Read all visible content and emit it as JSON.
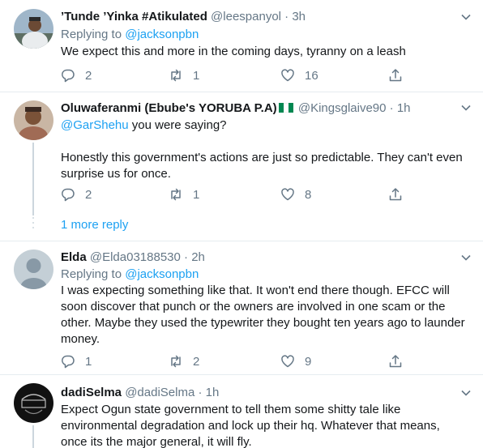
{
  "tweets": [
    {
      "name": "’Tunde ’Yinka #Atikulated",
      "handle": "@leespanyol",
      "sep": "·",
      "time": "3h",
      "replying_prefix": "Replying to ",
      "replying_to": "@jacksonpbn",
      "text": "We expect this and more in the coming days, tyranny on a leash",
      "replies": "2",
      "retweets": "1",
      "likes": "16"
    },
    {
      "name": "Oluwaferanmi (Ebube's YORUBA P.A)",
      "handle": "@Kingsglaive90",
      "sep": "·",
      "time": "1h",
      "mention": "@GarShehu",
      "text_line1_rest": " you were saying?",
      "text_para2": "Honestly this government's actions are just so predictable. They can't even surprise us for once.",
      "replies": "2",
      "retweets": "1",
      "likes": "8",
      "flag_colors": [
        "#008751",
        "#ffffff",
        "#008751"
      ]
    },
    {
      "name": "Elda",
      "handle": "@Elda03188530",
      "sep": "·",
      "time": "2h",
      "replying_prefix": "Replying to ",
      "replying_to": "@jacksonpbn",
      "text": "I was expecting something like that. It won't end there though. EFCC will soon discover that punch or the owners are involved in one scam or the other. Maybe they used the typewriter they bought ten years ago to launder money.",
      "replies": "1",
      "retweets": "2",
      "likes": "9"
    },
    {
      "name": "dadiSelma",
      "handle": "@dadiSelma",
      "sep": "·",
      "time": "1h",
      "text": "Expect Ogun state government to tell them some shitty tale like environmental degradation and lock up their hq. Whatever that means, once its the major general, it will fly."
    }
  ],
  "more_replies": "1 more reply",
  "icons": [
    "chevron-down-icon",
    "reply-icon",
    "retweet-icon",
    "like-icon",
    "share-icon"
  ],
  "colors": {
    "link": "#1da1f2",
    "muted": "#657786",
    "divider": "#e6ecf0"
  }
}
